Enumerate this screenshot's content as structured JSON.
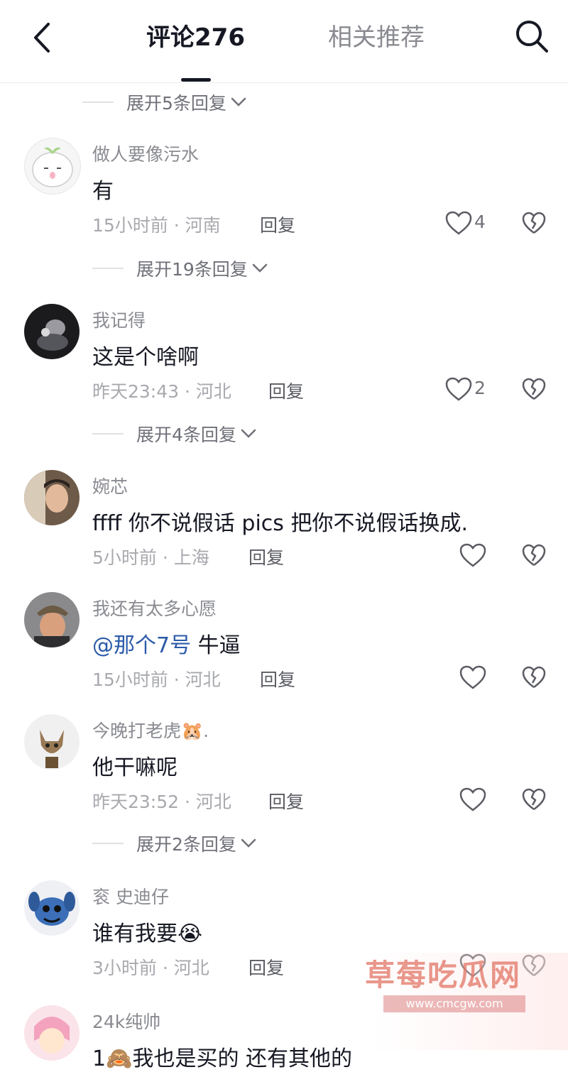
{
  "header": {
    "tab_comments": "评论276",
    "tab_related": "相关推荐"
  },
  "expanders": {
    "e0": "展开5条回复",
    "e1": "展开19条回复",
    "e2": "展开4条回复",
    "e3": "展开2条回复"
  },
  "comments": [
    {
      "user": "做人要像污水",
      "text": "有",
      "time": "15小时前 · 河南",
      "reply": "回复",
      "likes": "4"
    },
    {
      "user": "我记得",
      "text": "这是个啥啊",
      "time": "昨天23:43 · 河北",
      "reply": "回复",
      "likes": "2"
    },
    {
      "user": "婉芯",
      "text": "ffff 你不说假话 pics 把你不说假话换成.",
      "time": "5小时前 · 上海",
      "reply": "回复",
      "likes": ""
    },
    {
      "user": "我还有太多心愿",
      "mention": "@那个7号",
      "text": " 牛逼",
      "time": "15小时前 · 河北",
      "reply": "回复",
      "likes": ""
    },
    {
      "user": "今晚打老虎🐹.",
      "text": "他干嘛呢",
      "time": "昨天23:52 · 河北",
      "reply": "回复",
      "likes": ""
    },
    {
      "user": "衮 史迪仔",
      "text": "谁有我要😭",
      "time": "3小时前 · 河北",
      "reply": "回复",
      "likes": ""
    },
    {
      "user": "24k纯帅",
      "text": "1🙈我也是买的 还有其他的",
      "time": "",
      "reply": "",
      "likes": ""
    }
  ],
  "watermark": {
    "title": "草莓吃瓜网",
    "url": "www.cmcgw.com"
  },
  "colors": {
    "mention": "#2b5aa8",
    "text": "#161823",
    "muted": "#8a8b91"
  }
}
